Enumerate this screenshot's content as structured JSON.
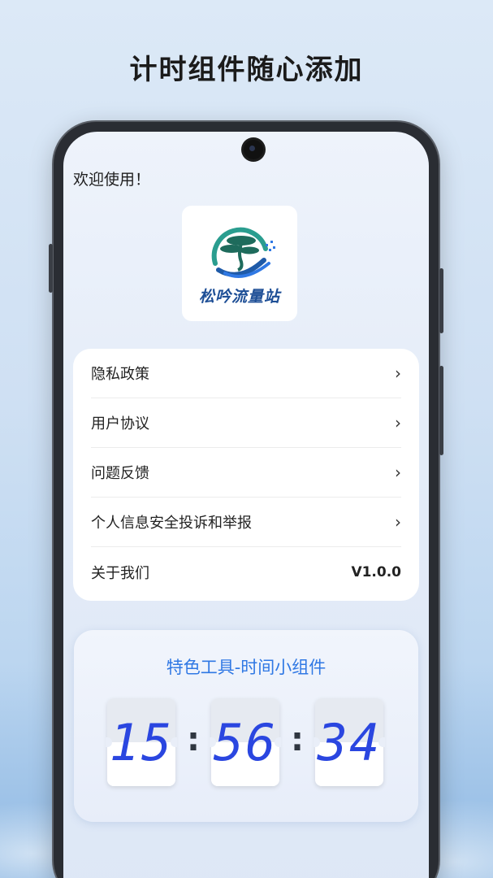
{
  "headline": "计时组件随心添加",
  "app": {
    "welcome": "欢迎使用！",
    "logo_text": "松吟流量站",
    "menu": [
      {
        "label": "隐私政策",
        "icon": "chevron-right-icon",
        "glyph": "›"
      },
      {
        "label": "用户协议",
        "icon": "chevron-right-icon",
        "glyph": "›"
      },
      {
        "label": "问题反馈",
        "icon": "chevron-right-icon",
        "glyph": "›"
      },
      {
        "label": "个人信息安全投诉和举报",
        "icon": "chevron-right-icon",
        "glyph": "›"
      },
      {
        "label": "关于我们",
        "value": "V1.0.0"
      }
    ],
    "widget": {
      "title": "特色工具-时间小组件",
      "hours": "15",
      "minutes": "56",
      "seconds": "34",
      "separator": ":"
    }
  },
  "colors": {
    "accent": "#2f78e4",
    "digit": "#2a46e0",
    "logo_green": "#2a9d8f",
    "logo_blue": "#1e4f96"
  }
}
